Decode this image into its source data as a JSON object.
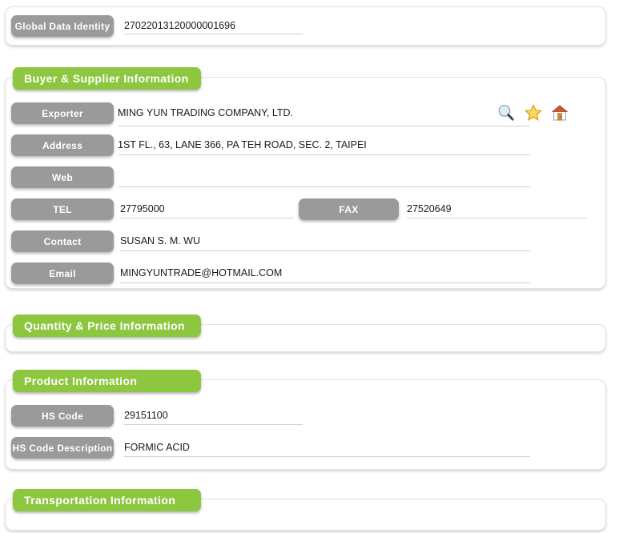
{
  "sections": [
    {
      "id": "global",
      "title": null,
      "has_header": false
    },
    {
      "id": "buyer_supplier",
      "title": "Buyer & Supplier Information",
      "has_header": true
    },
    {
      "id": "quantity_price",
      "title": "Quantity & Price Information",
      "has_header": true
    },
    {
      "id": "product",
      "title": "Product Information",
      "has_header": true
    },
    {
      "id": "transportation",
      "title": "Transportation Information",
      "has_header": true
    }
  ],
  "global": {
    "label": "Global Data Identity",
    "value": "27022013120000001696"
  },
  "buyer_supplier": {
    "title": "Buyer & Supplier Information",
    "fields": {
      "exporter_label": "Exporter",
      "exporter_value": "MING YUN TRADING COMPANY, LTD.",
      "address_label": "Address",
      "address_value": "1ST FL., 63, LANE 366, PA TEH ROAD, SEC. 2, TAIPEI",
      "web_label": "Web",
      "web_value": "",
      "tel_label": "TEL",
      "tel_value": "27795000",
      "fax_label": "FAX",
      "fax_value": "27520649",
      "contact_label": "Contact",
      "contact_value": "SUSAN S. M. WU",
      "email_label": "Email",
      "email_value": "MINGYUNTRADE@HOTMAIL.COM"
    },
    "actions": [
      {
        "name": "search-icon",
        "title": "Search"
      },
      {
        "name": "star-icon",
        "title": "Favorite"
      },
      {
        "name": "home-icon",
        "title": "Home"
      }
    ]
  },
  "quantity_price": {
    "title": "Quantity & Price Information"
  },
  "product": {
    "title": "Product Information",
    "fields": {
      "hs_code_label": "HS Code",
      "hs_code_value": "29151100",
      "hs_code_desc_label": "HS Code Description",
      "hs_code_desc_value": "FORMIC ACID"
    }
  },
  "transportation": {
    "title": "Transportation Information"
  },
  "colors": {
    "accent_green": "#8dc63f",
    "label_gray": "#9a9a9a",
    "panel_border": "#e2e2e2",
    "underline": "#d2d2d2",
    "text": "#1a1a1a"
  }
}
